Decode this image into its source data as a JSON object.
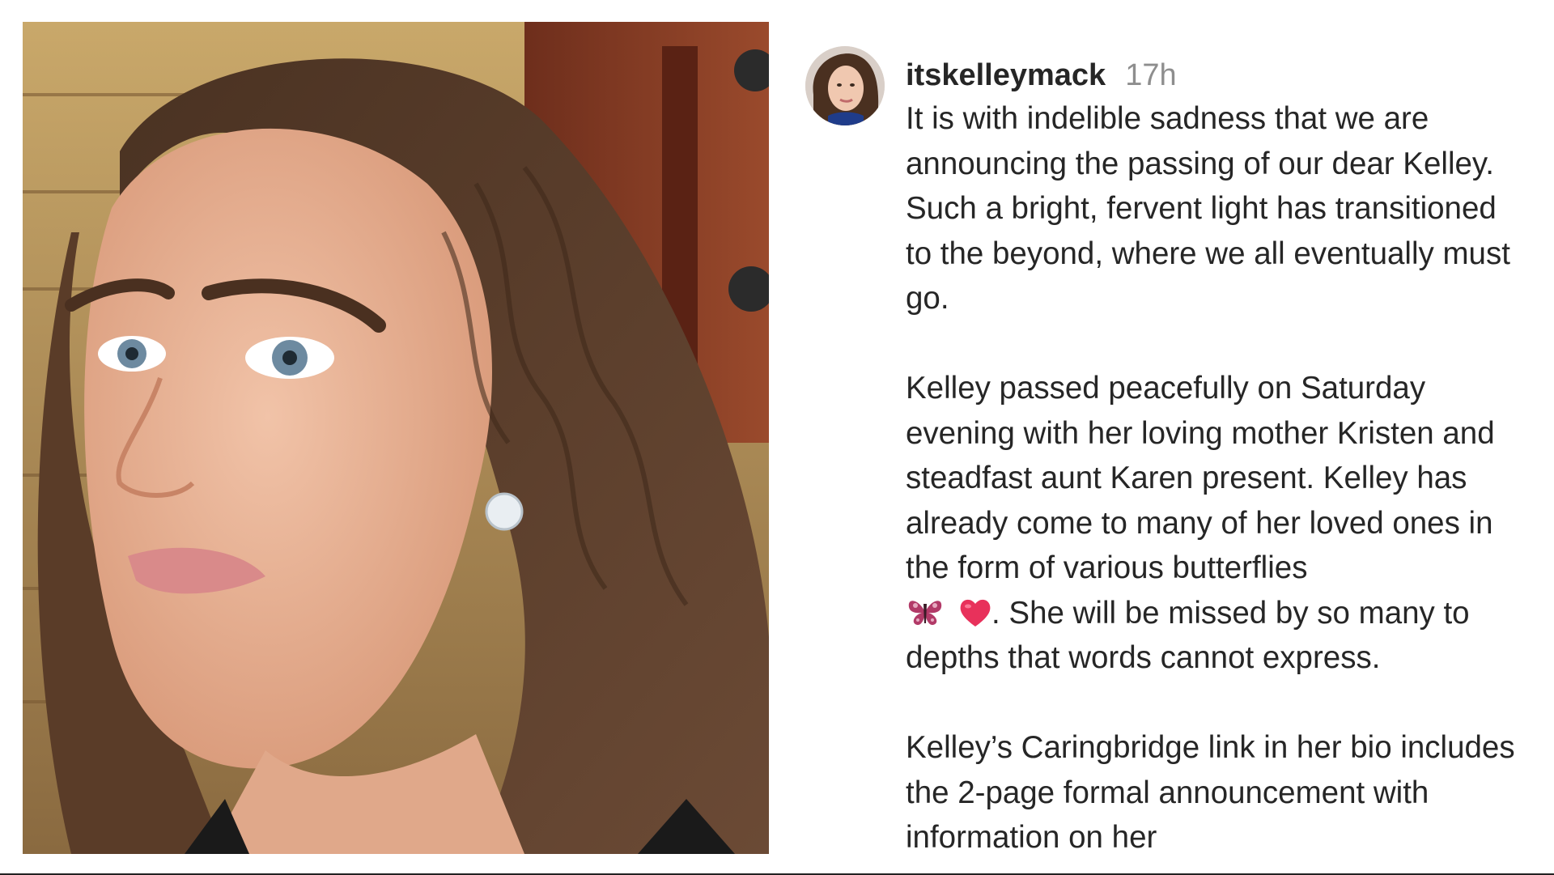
{
  "post": {
    "username": "itskelleymack",
    "timestamp": "17h",
    "caption": {
      "paragraph_1": "It is with indelible sadness that we are announcing the passing of our dear Kelley. Such a bright, fervent light has transitioned to the beyond, where we all eventually must go.",
      "paragraph_2_text": "Kelley passed peacefully on Saturday evening with her loving mother Kristen and steadfast aunt Karen present. Kelley has already come to many of her loved ones in the form of various butterflies",
      "paragraph_2_tail": ". She will be missed by so many to depths that words cannot express.",
      "paragraph_3": "Kelley’s Caringbridge link in her bio includes the 2-page formal announcement with information on her"
    },
    "emojis": [
      "butterfly-emoji",
      "red-heart-emoji"
    ]
  },
  "colors": {
    "text": "#262626",
    "muted": "#8e8e8e",
    "heart": "#e8315b",
    "butterfly": "#b23a68"
  }
}
